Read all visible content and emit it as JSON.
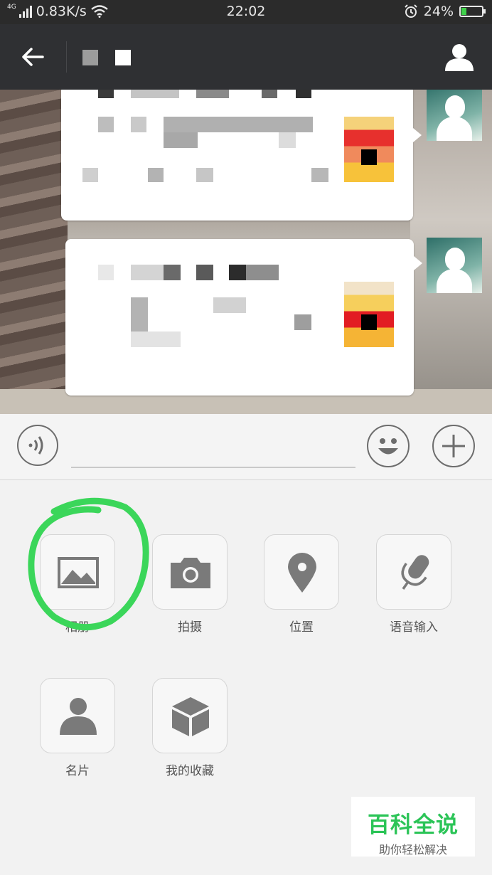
{
  "status_bar": {
    "network_type": "4G",
    "speed": "0.83K/s",
    "time": "22:02",
    "battery": "24%",
    "battery_level": 0.24
  },
  "chat": {
    "title_blocks": [
      "gray-square",
      "white-square"
    ]
  },
  "input_bar": {
    "voice_icon": "voice-icon",
    "emoji_icon": "emoji-icon",
    "plus_icon": "plus-icon"
  },
  "panel": {
    "items": [
      {
        "label": "相册",
        "icon": "image-icon"
      },
      {
        "label": "拍摄",
        "icon": "camera-icon"
      },
      {
        "label": "位置",
        "icon": "location-pin-icon"
      },
      {
        "label": "语音输入",
        "icon": "microphone-icon"
      },
      {
        "label": "名片",
        "icon": "contact-card-icon"
      },
      {
        "label": "我的收藏",
        "icon": "favorites-box-icon"
      }
    ]
  },
  "watermark": {
    "title": "百科全说",
    "subtitle": "助你轻松解决"
  },
  "colors": {
    "nav": "#2f3033",
    "panel": "#f2f2f2",
    "highlight": "#3bd65a",
    "watermark_green": "#2bc457"
  }
}
